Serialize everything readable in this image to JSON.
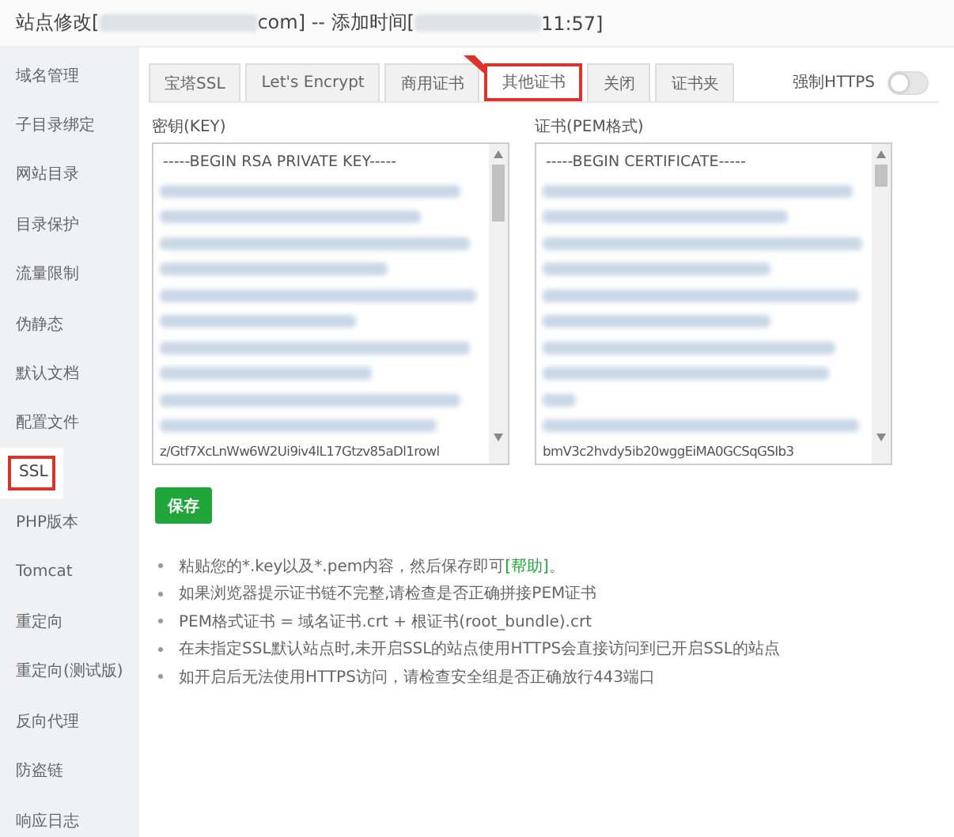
{
  "window": {
    "title_parts": [
      "站点修改[",
      "com] -- 添加时间[",
      "11:57]"
    ]
  },
  "sidebar": {
    "items": [
      {
        "label": "域名管理",
        "selected": false
      },
      {
        "label": "子目录绑定",
        "selected": false
      },
      {
        "label": "网站目录",
        "selected": false
      },
      {
        "label": "目录保护",
        "selected": false
      },
      {
        "label": "流量限制",
        "selected": false
      },
      {
        "label": "伪静态",
        "selected": false
      },
      {
        "label": "默认文档",
        "selected": false
      },
      {
        "label": "配置文件",
        "selected": false
      },
      {
        "label": "SSL",
        "selected": true
      },
      {
        "label": "PHP版本",
        "selected": false
      },
      {
        "label": "Tomcat",
        "selected": false
      },
      {
        "label": "重定向",
        "selected": false
      },
      {
        "label": "重定向(测试版)",
        "selected": false
      },
      {
        "label": "反向代理",
        "selected": false
      },
      {
        "label": "防盗链",
        "selected": false
      },
      {
        "label": "响应日志",
        "selected": false
      }
    ]
  },
  "tabs": [
    {
      "label": "宝塔SSL",
      "selected": false,
      "ribbon": false
    },
    {
      "label": "Let's Encrypt",
      "selected": false,
      "ribbon": false
    },
    {
      "label": "商用证书",
      "selected": false,
      "ribbon": true
    },
    {
      "label": "其他证书",
      "selected": true,
      "ribbon": false
    },
    {
      "label": "关闭",
      "selected": false,
      "ribbon": false
    },
    {
      "label": "证书夹",
      "selected": false,
      "ribbon": false
    }
  ],
  "force_https": {
    "label": "强制HTTPS",
    "on": false
  },
  "editors": [
    {
      "label": "密钥(KEY)",
      "first_line": "-----BEGIN RSA PRIVATE KEY-----",
      "last_line": "z/Gtf7XcLnWw6W2Ui9iv4lL17Gtzv85aDl1rowl"
    },
    {
      "label": "证书(PEM格式)",
      "first_line": "-----BEGIN CERTIFICATE-----",
      "last_line": "bmV3c2hvdy5ib20wggEiMA0GCSqGSIb3"
    }
  ],
  "save_button": "保存",
  "notes": [
    {
      "text": "粘贴您的*.key以及*.pem内容，然后保存即可",
      "link": "[帮助]",
      "tail": "。"
    },
    {
      "text": "如果浏览器提示证书链不完整,请检查是否正确拼接PEM证书"
    },
    {
      "text": "PEM格式证书 = 域名证书.crt + 根证书(root_bundle).crt"
    },
    {
      "text": "在未指定SSL默认站点时,未开启SSL的站点使用HTTPS会直接访问到已开启SSL的站点"
    },
    {
      "text": "如开启后无法使用HTTPS访问，请检查安全组是否正确放行443端口"
    }
  ]
}
